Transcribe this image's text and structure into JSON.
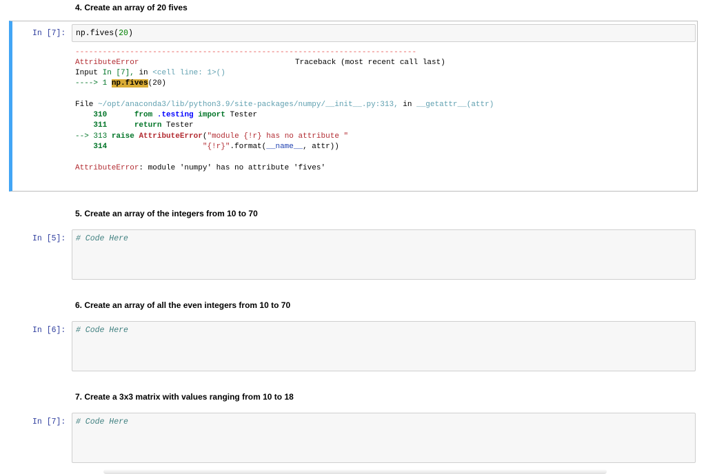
{
  "cells": {
    "heading4": "4. Create an array of 20 fives",
    "cell7a": {
      "prompt": "In [7]:",
      "code_fn": "np.fives(",
      "code_arg": "20",
      "code_close": ")"
    },
    "traceback": {
      "dashes": "---------------------------------------------------------------------------",
      "error_name": "AttributeError",
      "traceback_label": "Traceback (most recent call last)",
      "input_label": "Input",
      "input_ref": "In [7],",
      "input_in": "in",
      "cell_line": "<cell line: 1>()",
      "arrow1": "----> 1 ",
      "hl_code": "np.fives",
      "arrow1_rest": "(20)",
      "file_label": "File",
      "file_path": "~/opt/anaconda3/lib/python3.9/site-packages/numpy/__init__.py:313,",
      "file_in": "in",
      "file_func": "__getattr__(attr)",
      "l310_num": "310",
      "l310_from": "from",
      "l310_mod": ".testing",
      "l310_import": "import",
      "l310_rest": "Tester",
      "l311_num": "311",
      "l311_return": "return",
      "l311_rest": "Tester",
      "l313_arrow": "--> 313",
      "l313_raise": "raise",
      "l313_exc": "AttributeError",
      "l313_open": "(",
      "l313_str": "\"module {!r} has no attribute \"",
      "l314_num": "314",
      "l314_str": "\"{!r}\"",
      "l314_rest": ".format(",
      "l314_name": "__name__",
      "l314_end": ", attr))",
      "final_name": "AttributeError",
      "final_msg": ": module 'numpy' has no attribute 'fives'"
    },
    "heading5": "5. Create an array of the integers from 10 to 70",
    "cell5": {
      "prompt": "In [5]:",
      "code": "# Code Here"
    },
    "heading6": "6. Create an array of all the even integers from 10 to 70",
    "cell6": {
      "prompt": "In [6]:",
      "code": "# Code Here"
    },
    "heading7": "7. Create a 3x3 matrix with values ranging from 10 to 18",
    "cell7b": {
      "prompt": "In [7]:",
      "code": "# Code Here"
    }
  }
}
